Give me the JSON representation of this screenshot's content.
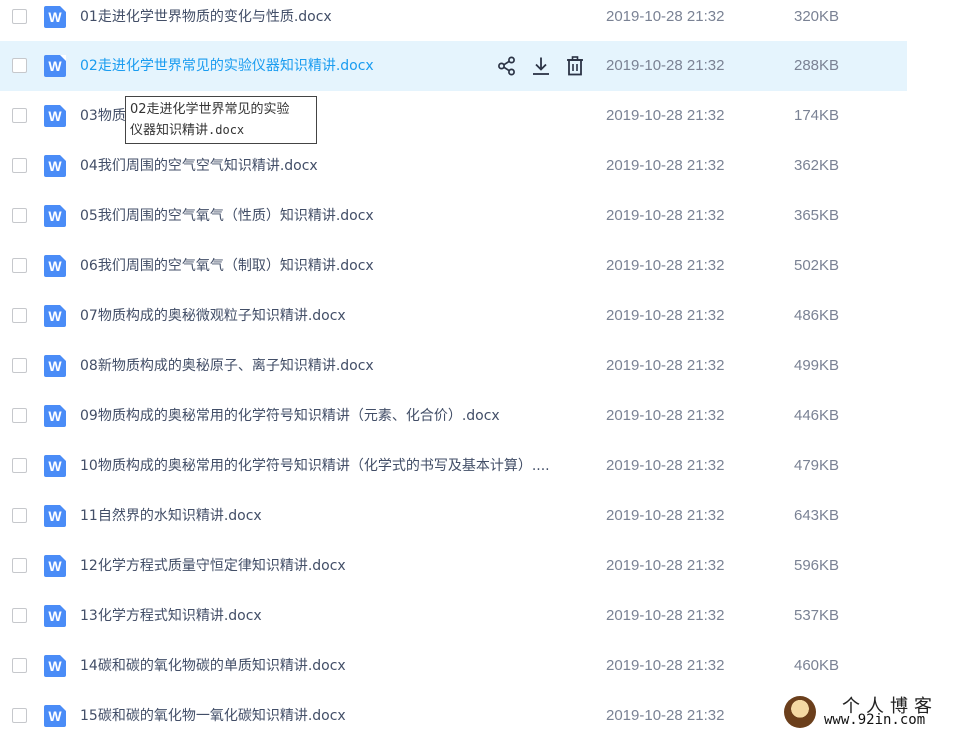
{
  "files": [
    {
      "name": "01走进化学世界物质的变化与性质.docx",
      "date": "2019-10-28 21:32",
      "size": "320KB",
      "icon": "word-doc-icon",
      "icon_letter": "W"
    },
    {
      "name": "02走进化学世界常见的实验仪器知识精讲.docx",
      "date": "2019-10-28 21:32",
      "size": "288KB",
      "icon": "word-doc-icon",
      "icon_letter": "W",
      "hovered": true
    },
    {
      "name": "03物质",
      "date": "2019-10-28 21:32",
      "size": "174KB",
      "icon": "word-doc-icon",
      "icon_letter": "W"
    },
    {
      "name": "04我们周围的空气空气知识精讲.docx",
      "date": "2019-10-28 21:32",
      "size": "362KB",
      "icon": "word-doc-icon",
      "icon_letter": "W"
    },
    {
      "name": "05我们周围的空气氧气（性质）知识精讲.docx",
      "date": "2019-10-28 21:32",
      "size": "365KB",
      "icon": "word-doc-icon",
      "icon_letter": "W"
    },
    {
      "name": "06我们周围的空气氧气（制取）知识精讲.docx",
      "date": "2019-10-28 21:32",
      "size": "502KB",
      "icon": "word-doc-icon",
      "icon_letter": "W"
    },
    {
      "name": "07物质构成的奥秘微观粒子知识精讲.docx",
      "date": "2019-10-28 21:32",
      "size": "486KB",
      "icon": "word-doc-icon",
      "icon_letter": "W"
    },
    {
      "name": "08新物质构成的奥秘原子、离子知识精讲.docx",
      "date": "2019-10-28 21:32",
      "size": "499KB",
      "icon": "word-doc-icon",
      "icon_letter": "W"
    },
    {
      "name": "09物质构成的奥秘常用的化学符号知识精讲（元素、化合价）.docx",
      "date": "2019-10-28 21:32",
      "size": "446KB",
      "icon": "word-doc-icon",
      "icon_letter": "W"
    },
    {
      "name": "10物质构成的奥秘常用的化学符号知识精讲（化学式的书写及基本计算）....",
      "date": "2019-10-28 21:32",
      "size": "479KB",
      "icon": "word-doc-icon",
      "icon_letter": "W"
    },
    {
      "name": "11自然界的水知识精讲.docx",
      "date": "2019-10-28 21:32",
      "size": "643KB",
      "icon": "word-doc-icon",
      "icon_letter": "W"
    },
    {
      "name": "12化学方程式质量守恒定律知识精讲.docx",
      "date": "2019-10-28 21:32",
      "size": "596KB",
      "icon": "word-doc-icon",
      "icon_letter": "W"
    },
    {
      "name": "13化学方程式知识精讲.docx",
      "date": "2019-10-28 21:32",
      "size": "537KB",
      "icon": "word-doc-icon",
      "icon_letter": "W"
    },
    {
      "name": "14碳和碳的氧化物碳的单质知识精讲.docx",
      "date": "2019-10-28 21:32",
      "size": "460KB",
      "icon": "word-doc-icon",
      "icon_letter": "W"
    },
    {
      "name": "15碳和碳的氧化物一氧化碳知识精讲.docx",
      "date": "2019-10-28 21:32",
      "size": "",
      "icon": "word-doc-icon",
      "icon_letter": "W"
    }
  ],
  "hover_actions": [
    {
      "icon": "share-icon"
    },
    {
      "icon": "download-icon"
    },
    {
      "icon": "delete-icon"
    }
  ],
  "tooltip": {
    "line1": "02走进化学世界常见的实验",
    "line2_cn": "仪器知识精讲",
    "line2_ext": ".docx"
  },
  "watermark": {
    "title": "个人博客",
    "url": "www.92in.com"
  },
  "colors": {
    "hover_row_bg": "#e5f4fd",
    "hover_text": "#1a9cf0",
    "word_icon": "#4a8cf7",
    "meta_text": "#7a8294"
  }
}
